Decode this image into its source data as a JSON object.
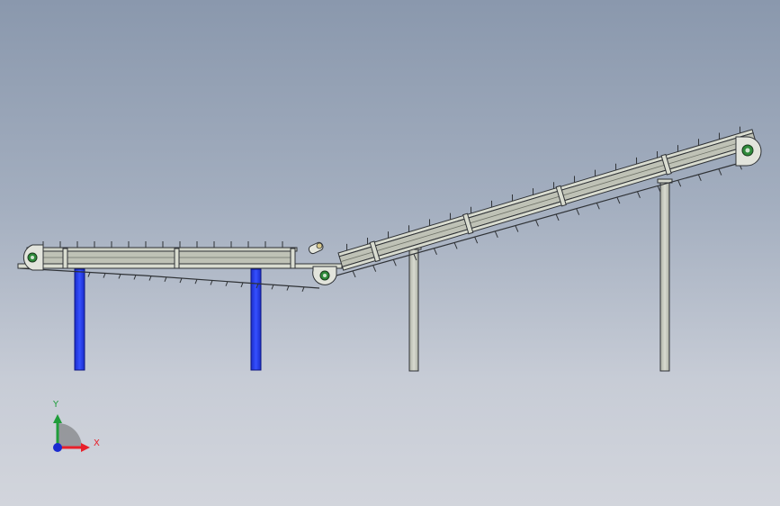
{
  "triad": {
    "x_label": "X",
    "y_label": "Y"
  },
  "colors": {
    "background_top": "#8a98ad",
    "background_bottom": "#d2d5dc",
    "frame": "#c9ccc0",
    "frame_outline": "#2f3236",
    "legs_selected": "#1f35e8",
    "legs_unselected": "#c9ccc0",
    "bearing": "#2e8a3a",
    "axis_x": "#e8202a",
    "axis_y": "#1f9d3a",
    "axis_z": "#1a2bd0"
  }
}
